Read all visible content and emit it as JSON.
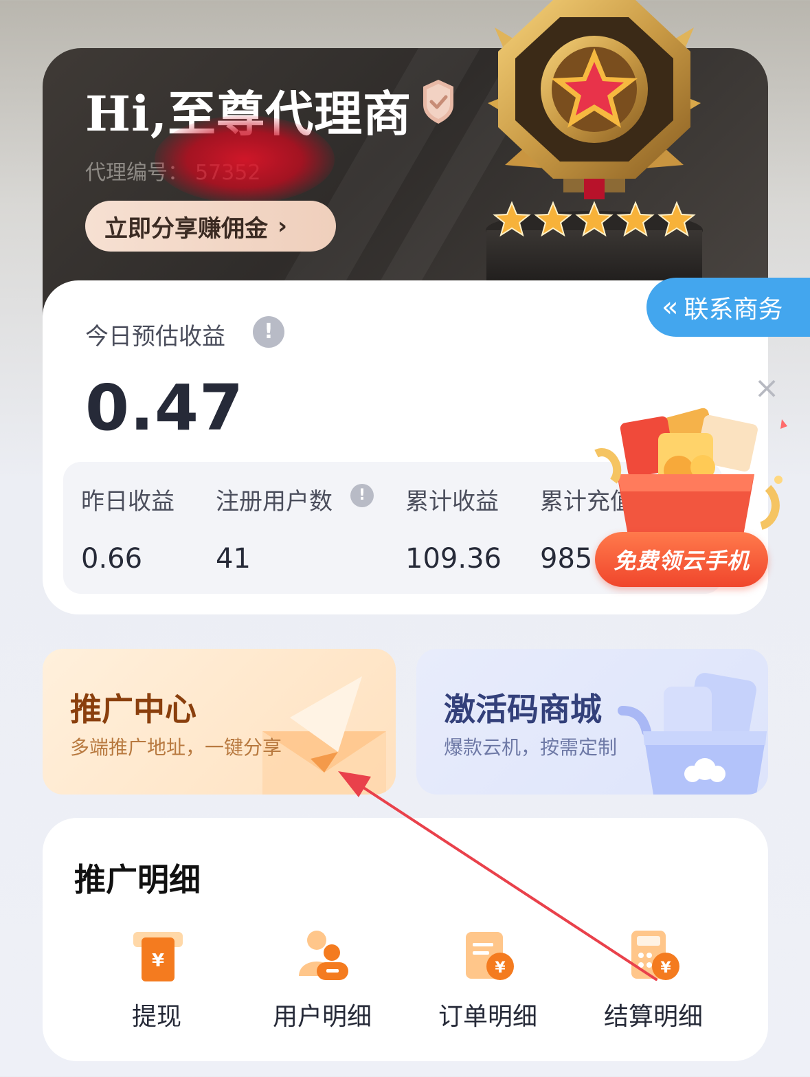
{
  "header": {
    "greeting": "Hi,至尊代理商",
    "agent_id_label": "代理编号：",
    "agent_id_value": "57352",
    "share_button": "立即分享赚佣金",
    "share_arrow": "›"
  },
  "contact": {
    "chevron": "«",
    "label": "联系商务"
  },
  "earnings": {
    "today_label": "今日预估收益",
    "info_icon": "!",
    "today_value": "0.47",
    "stats": [
      {
        "label": "昨日收益",
        "value": "0.66"
      },
      {
        "label": "注册用户数",
        "value": "41"
      },
      {
        "label": "累计收益",
        "value": "109.36"
      },
      {
        "label": "累计充值",
        "value": "985"
      }
    ]
  },
  "popup": {
    "close": "×",
    "banner": "免费领云手机"
  },
  "promo": {
    "left": {
      "title": "推广中心",
      "subtitle": "多端推广地址，一键分享"
    },
    "right": {
      "title": "激活码商城",
      "subtitle": "爆款云机，按需定制"
    }
  },
  "details": {
    "title": "推广明细",
    "items": [
      {
        "label": "提现",
        "icon": "withdraw-icon"
      },
      {
        "label": "用户明细",
        "icon": "users-icon"
      },
      {
        "label": "订单明细",
        "icon": "order-icon"
      },
      {
        "label": "结算明细",
        "icon": "settlement-icon"
      }
    ]
  },
  "colors": {
    "accent_orange": "#f47b1f",
    "contact_blue": "#43a6ee",
    "annotation_red": "#e9414b"
  }
}
